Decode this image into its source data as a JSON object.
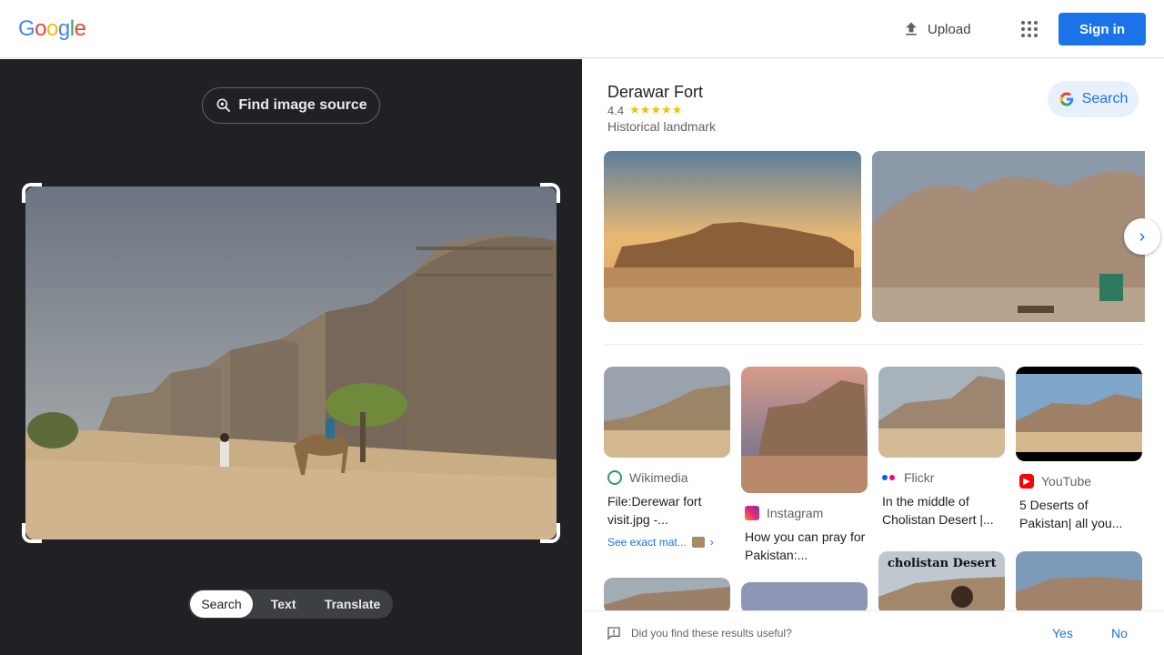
{
  "header": {
    "logo": [
      "G",
      "o",
      "o",
      "g",
      "l",
      "e"
    ],
    "logo_colors": [
      "#4285f4",
      "#ea4335",
      "#fbbc05",
      "#4285f4",
      "#34a853",
      "#ea4335"
    ],
    "upload_label": "Upload",
    "apps_icon": "apps-grid-icon",
    "signin_label": "Sign in"
  },
  "left": {
    "find_source_label": "Find image source",
    "modes": [
      "Search",
      "Text",
      "Translate"
    ],
    "active_mode": "Search"
  },
  "knowledge": {
    "title": "Derawar Fort",
    "rating": "4.4",
    "stars": "★★★★★",
    "type": "Historical landmark",
    "search_label": "Search"
  },
  "results": [
    {
      "source": "Wikimedia",
      "title": "File:Derewar fort visit.jpg -...",
      "link": "See exact mat..."
    },
    {
      "source": "Instagram",
      "title": "How you can pray for Pakistan:..."
    },
    {
      "source": "Flickr",
      "title": "In the middle of Cholistan Desert |..."
    },
    {
      "source": "YouTube",
      "title": "5 Deserts of Pakistan| all you..."
    }
  ],
  "thumb_caption": "cholistan Desert",
  "feedback": {
    "question": "Did you find these results useful?",
    "yes": "Yes",
    "no": "No"
  },
  "colors": {
    "accent": "#1a73e8",
    "left_bg": "#202124",
    "star": "#fbbc04"
  }
}
